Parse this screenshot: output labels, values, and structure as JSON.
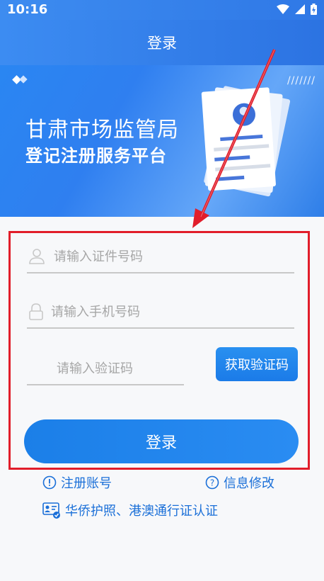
{
  "status_bar": {
    "time": "10:16"
  },
  "app_bar": {
    "title": "登录"
  },
  "banner": {
    "title_line1": "甘肃市场监管局",
    "title_line2": "登记注册服务平台",
    "decoration": "///////"
  },
  "form": {
    "id_placeholder": "请输入证件号码",
    "phone_placeholder": "请输入手机号码",
    "code_placeholder": "请输入验证码",
    "get_code_label": "获取验证码",
    "login_label": "登录"
  },
  "links": {
    "register": "注册账号",
    "modify_info": "信息修改",
    "overseas_auth": "华侨护照、港澳通行证认证"
  },
  "colors": {
    "accent": "#1b7fe8",
    "annotation": "#e11d2a"
  }
}
